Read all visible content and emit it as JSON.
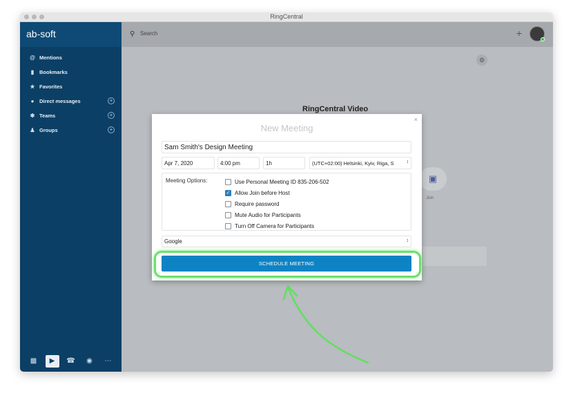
{
  "window": {
    "title": "RingCentral"
  },
  "sidebar": {
    "brand": "ab-soft",
    "items": [
      {
        "label": "Mentions",
        "icon": "at-icon",
        "has_add": false
      },
      {
        "label": "Bookmarks",
        "icon": "bookmark-icon",
        "has_add": false
      },
      {
        "label": "Favorites",
        "icon": "star-icon",
        "has_add": false
      },
      {
        "label": "Direct messages",
        "icon": "person-icon",
        "has_add": true
      },
      {
        "label": "Teams",
        "icon": "teams-icon",
        "has_add": true
      },
      {
        "label": "Groups",
        "icon": "groups-icon",
        "has_add": true
      }
    ],
    "bottom_icons": [
      "messages-icon",
      "video-icon",
      "phone-icon",
      "contacts-icon",
      "more-icon"
    ]
  },
  "topbar": {
    "search_placeholder": "Search"
  },
  "main": {
    "video_title": "RingCentral Video",
    "join_label": "Join"
  },
  "modal": {
    "title": "New Meeting",
    "meeting_name": "Sam Smith's Design Meeting",
    "date": "Apr 7, 2020",
    "time": "4:00 pm",
    "duration": "1h",
    "timezone": "(UTC+02:00) Helsinki, Kyiv, Riga, S",
    "options_label": "Meeting Options:",
    "options": [
      {
        "label": "Use Personal Meeting ID 835-206-502",
        "checked": false
      },
      {
        "label": "Allow Join before Host",
        "checked": true
      },
      {
        "label": "Require password",
        "checked": false
      },
      {
        "label": "Mute Audio for Participants",
        "checked": false
      },
      {
        "label": "Turn Off Camera for Participants",
        "checked": false
      }
    ],
    "provider": "Google",
    "schedule_button": "SCHEDULE MEETING"
  },
  "colors": {
    "sidebar_bg": "#0b3f66",
    "primary_button": "#0e83c4",
    "highlight": "#6be06b",
    "checkbox_checked": "#2b7fc1"
  }
}
